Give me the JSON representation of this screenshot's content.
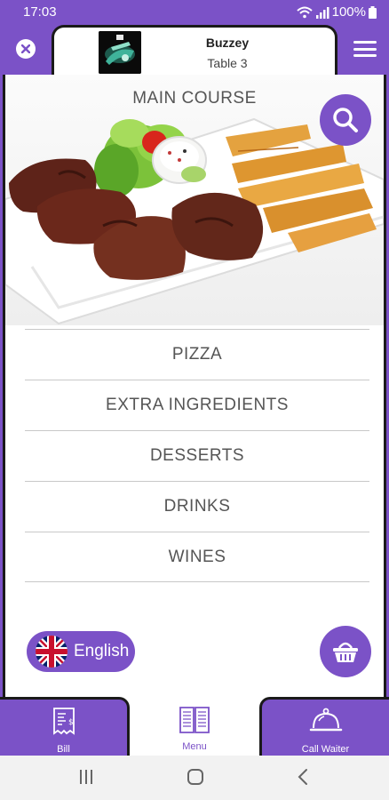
{
  "status": {
    "time": "17:03",
    "battery": "100%"
  },
  "header": {
    "title": "Buzzey",
    "subtitle": "Table 3"
  },
  "hero": {
    "title": "MAIN COURSE"
  },
  "categories": [
    {
      "label": "PIZZA"
    },
    {
      "label": "EXTRA INGREDIENTS"
    },
    {
      "label": "DESSERTS"
    },
    {
      "label": "DRINKS"
    },
    {
      "label": "WINES"
    }
  ],
  "language": {
    "label": "English",
    "flag": "uk-flag-icon"
  },
  "bottom_nav": [
    {
      "label": "Bill",
      "icon": "bill-icon"
    },
    {
      "label": "Menu",
      "icon": "menu-book-icon"
    },
    {
      "label": "Call Waiter",
      "icon": "service-bell-icon"
    }
  ],
  "colors": {
    "accent": "#7b52c7",
    "border": "#1a1a1a"
  }
}
